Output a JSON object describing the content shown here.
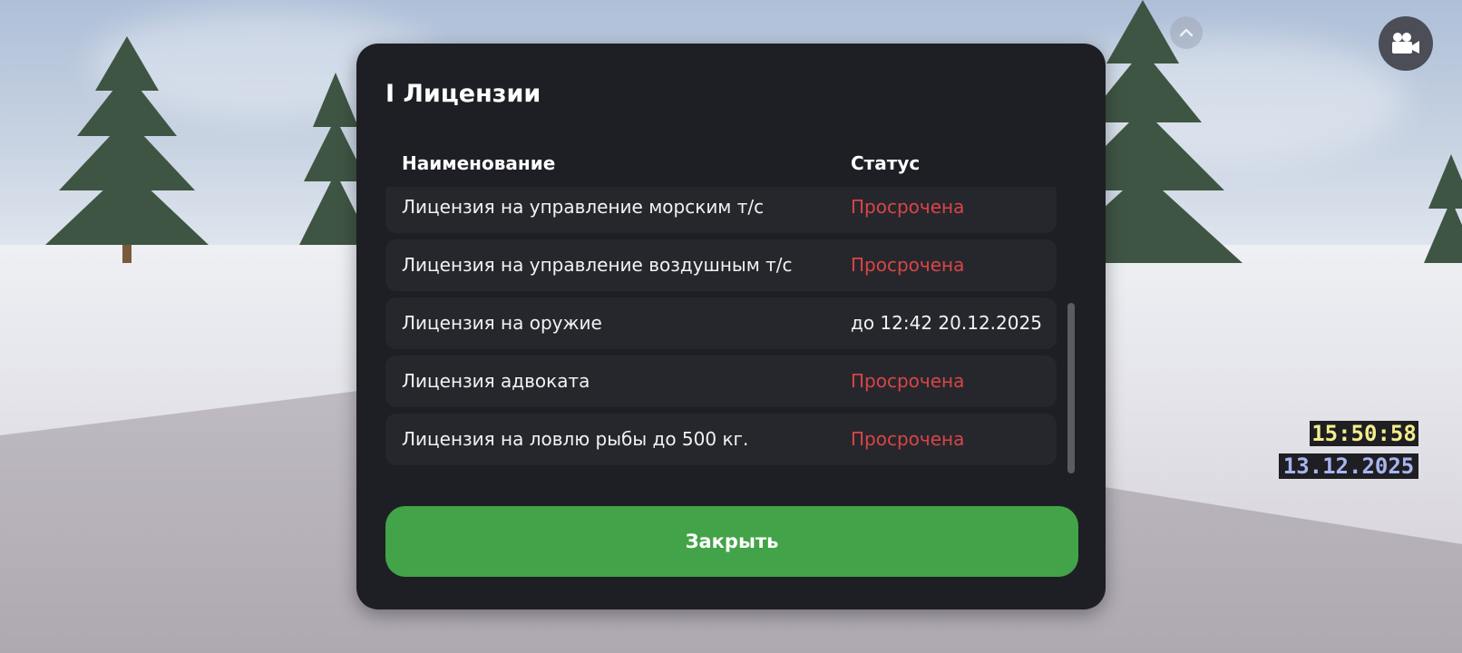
{
  "hud": {
    "time": "15:50:58",
    "date": "13.12.2025",
    "camera_icon": "camera-icon",
    "collapse_icon": "chevron-up-icon"
  },
  "modal": {
    "title": "I Лицензии",
    "columns": {
      "name": "Наименование",
      "status": "Статус"
    },
    "rows": [
      {
        "name": "Лицензия на управление морским т/с",
        "status": "Просрочена",
        "state": "expired"
      },
      {
        "name": "Лицензия на управление воздушным т/с",
        "status": "Просрочена",
        "state": "expired"
      },
      {
        "name": "Лицензия на оружие",
        "status": "до 12:42 20.12.2025",
        "state": "valid"
      },
      {
        "name": "Лицензия адвоката",
        "status": "Просрочена",
        "state": "expired"
      },
      {
        "name": "Лицензия на ловлю рыбы до 500 кг.",
        "status": "Просрочена",
        "state": "expired"
      }
    ],
    "close_label": "Закрыть"
  },
  "colors": {
    "modal_bg": "#1e1f24",
    "row_bg": "#26272d",
    "expired": "#d94545",
    "button": "#43a348",
    "hud_time": "#f3ee8c",
    "hud_date": "#a7b6f0"
  }
}
